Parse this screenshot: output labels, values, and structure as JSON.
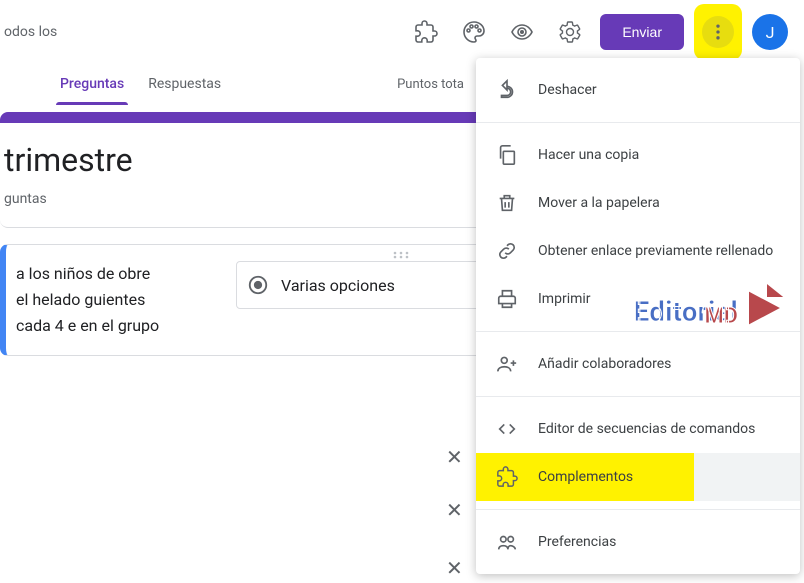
{
  "header": {
    "top_left_text": "odos los",
    "send_button": "Enviar",
    "avatar_initial": "J"
  },
  "tabs": {
    "questions": "Preguntas",
    "responses": "Respuestas",
    "points_label": "Puntos tota"
  },
  "form": {
    "title": "trimestre",
    "description": "guntas"
  },
  "question": {
    "text": "a los niños de obre el helado guientes cada 4 e  en el  grupo",
    "type_label": "Varias opciones"
  },
  "menu": {
    "undo": "Deshacer",
    "make_copy": "Hacer una copia",
    "move_trash": "Mover a la papelera",
    "prefilled_link": "Obtener enlace previamente rellenado",
    "print": "Imprimir",
    "add_collab": "Añadir colaboradores",
    "script_editor": "Editor de secuencias de comandos",
    "addons": "Complementos",
    "preferences": "Preferencias"
  },
  "watermark": {
    "part1": "Editorial",
    "part2": "MD"
  }
}
